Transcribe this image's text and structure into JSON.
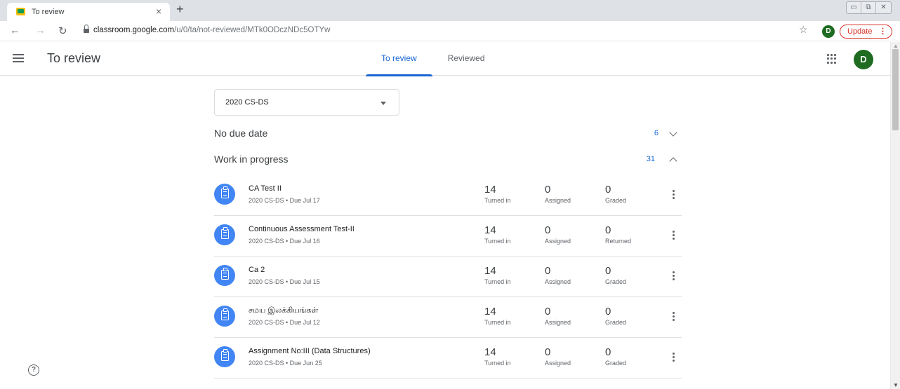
{
  "browser": {
    "tab_title": "To review",
    "tab_close": "×",
    "new_tab": "+",
    "url_host": "classroom.google.com",
    "url_path": "/u/0/ta/not-reviewed/MTk0ODczNDc5OTYw",
    "profile_initial": "D",
    "update_label": "Update",
    "update_menu": "⋮",
    "window_controls": [
      "▭",
      "⧉",
      "✕"
    ]
  },
  "header": {
    "title": "To review",
    "tabs": [
      "To review",
      "Reviewed"
    ],
    "active_tab": "To review",
    "avatar_initial": "D"
  },
  "class_select": {
    "selected": "2020 CS-DS"
  },
  "sections": [
    {
      "title": "No due date",
      "count": "6",
      "expanded": false
    },
    {
      "title": "Work in progress",
      "count": "31",
      "expanded": true
    }
  ],
  "assignments": [
    {
      "title": "CA Test II",
      "subtitle": "2020 CS-DS • Due Jul 17",
      "turned_in": "14",
      "turned_in_label": "Turned in",
      "assigned": "0",
      "assigned_label": "Assigned",
      "graded": "0",
      "graded_label": "Graded"
    },
    {
      "title": "Continuous Assessment Test-II",
      "subtitle": "2020 CS-DS • Due Jul 16",
      "turned_in": "14",
      "turned_in_label": "Turned in",
      "assigned": "0",
      "assigned_label": "Assigned",
      "graded": "0",
      "graded_label": "Returned"
    },
    {
      "title": "Ca 2",
      "subtitle": "2020 CS-DS • Due Jul 15",
      "turned_in": "14",
      "turned_in_label": "Turned in",
      "assigned": "0",
      "assigned_label": "Assigned",
      "graded": "0",
      "graded_label": "Graded"
    },
    {
      "title": "சமய இலக்கியங்கள்",
      "subtitle": "2020 CS-DS • Due Jul 12",
      "turned_in": "14",
      "turned_in_label": "Turned in",
      "assigned": "0",
      "assigned_label": "Assigned",
      "graded": "0",
      "graded_label": "Graded"
    },
    {
      "title": "Assignment No:III (Data Structures)",
      "subtitle": "2020 CS-DS • Due Jun 25",
      "turned_in": "14",
      "turned_in_label": "Turned in",
      "assigned": "0",
      "assigned_label": "Assigned",
      "graded": "0",
      "graded_label": "Graded"
    }
  ],
  "colors": {
    "accent": "#1967d2",
    "assignment_icon": "#4285f4",
    "avatar": "#1e6b21",
    "update": "#d93025"
  },
  "icons": {
    "menu": "menu-icon",
    "apps": "apps-icon",
    "assignment": "assignment-icon",
    "more": "more-vert-icon",
    "help": "help-icon"
  }
}
